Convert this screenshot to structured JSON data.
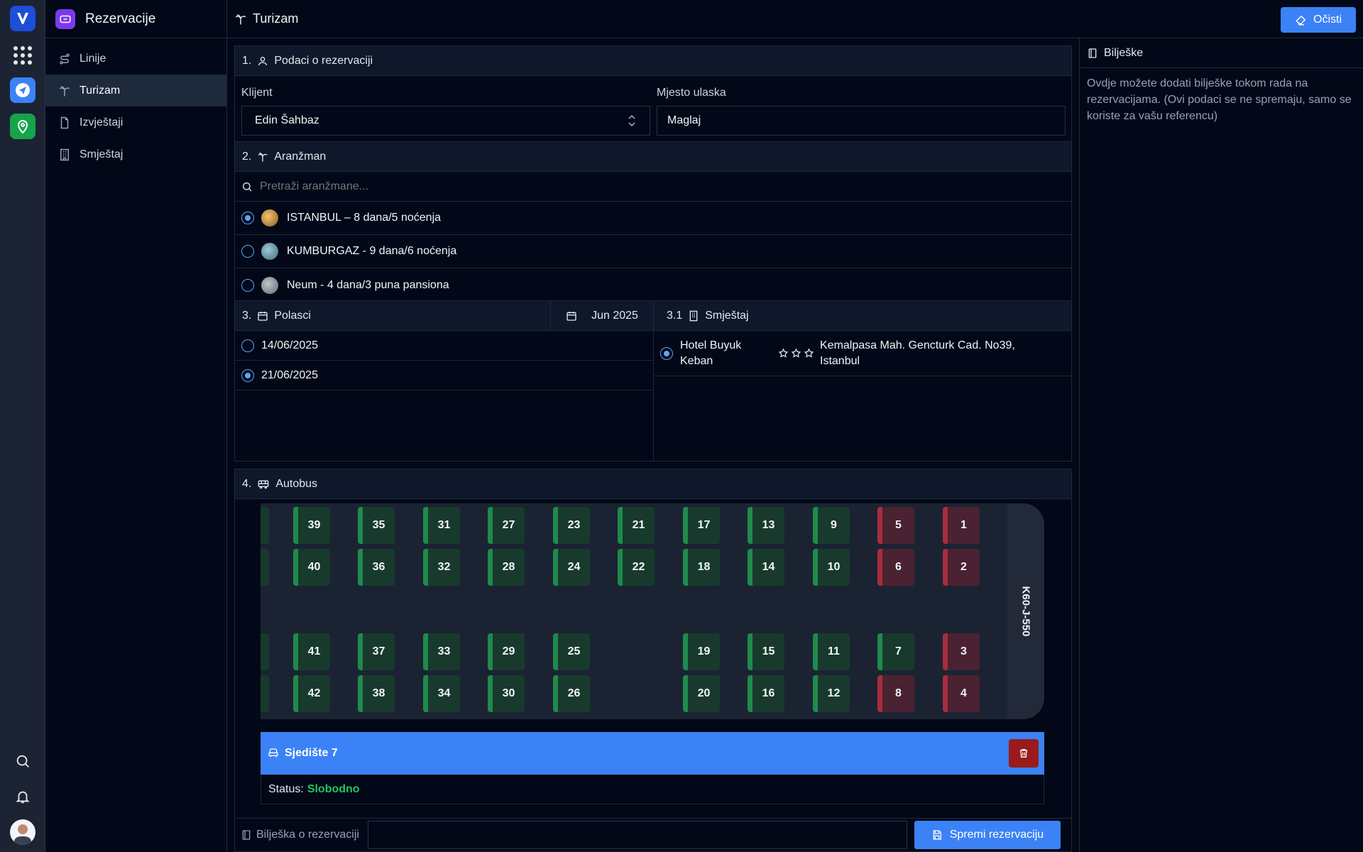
{
  "sidebar": {
    "title": "Rezervacije",
    "items": [
      {
        "label": "Linije",
        "icon": "route-icon",
        "active": false
      },
      {
        "label": "Turizam",
        "icon": "palm-tree-icon",
        "active": true
      },
      {
        "label": "Izvještaji",
        "icon": "file-icon",
        "active": false
      },
      {
        "label": "Smještaj",
        "icon": "building-icon",
        "active": false
      }
    ]
  },
  "topbar": {
    "title": "Turizam",
    "clear_label": "Očisti"
  },
  "section1": {
    "number": "1.",
    "title": "Podaci o rezervaciji",
    "client_label": "Klijent",
    "client_value": "Edin Šahbaz",
    "entry_label": "Mjesto ulaska",
    "entry_value": "Maglaj"
  },
  "section2": {
    "number": "2.",
    "title": "Aranžman",
    "search_placeholder": "Pretraži aranžmane...",
    "packages": [
      {
        "name": "ISTANBUL – 8 dana/5 noćenja",
        "selected": true
      },
      {
        "name": "KUMBURGAZ - 9 dana/6 noćenja",
        "selected": false
      },
      {
        "name": "Neum - 4 dana/3 puna pansiona",
        "selected": false
      }
    ]
  },
  "section3": {
    "number": "3.",
    "title": "Polasci",
    "month": "Jun 2025",
    "departures": [
      {
        "date": "14/06/2025",
        "selected": false
      },
      {
        "date": "21/06/2025",
        "selected": true
      }
    ]
  },
  "section31": {
    "number": "3.1",
    "title": "Smještaj",
    "hotel_name": "Hotel Buyuk Keban",
    "hotel_address": "Kemalpasa Mah. Gencturk Cad. No39, Istanbul",
    "stars": 3,
    "selected": true
  },
  "section4": {
    "number": "4.",
    "title": "Autobus",
    "plate": "K60-J-550",
    "seats_taken": [
      1,
      2,
      3,
      4,
      5,
      6,
      8
    ],
    "seats_free": [
      7,
      9,
      10,
      11,
      12,
      13,
      14,
      15,
      16,
      17,
      18,
      19,
      20,
      21,
      22,
      23,
      24,
      25,
      26,
      27,
      28,
      29,
      30,
      31,
      32,
      33,
      34,
      35,
      36,
      37,
      38,
      39,
      40,
      41,
      42
    ],
    "selected_seat": "Sjedište 7",
    "status_label": "Status:",
    "status_value": "Slobodno"
  },
  "footer": {
    "note_label": "Bilješka o rezervaciji",
    "note_value": "",
    "save_label": "Spremi rezervaciju"
  },
  "notes": {
    "title": "Bilješke",
    "text": "Ovdje možete dodati bilješke tokom rada na rezervacijama. (Ovi podaci se ne spremaju, samo se koriste za vašu referencu)"
  },
  "colors": {
    "accent": "#3b82f6",
    "free": "#1f8a4c",
    "taken": "#a72d3e",
    "status_free": "#22c55e"
  }
}
